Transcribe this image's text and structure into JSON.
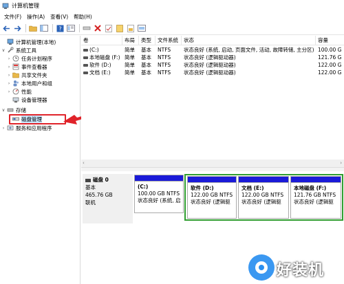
{
  "window": {
    "title": "计算机管理"
  },
  "menu": {
    "items": [
      "文件(F)",
      "操作(A)",
      "查看(V)",
      "帮助(H)"
    ]
  },
  "toolbar": {
    "buttons": [
      "back-icon",
      "forward-icon",
      "up-folder-icon",
      "show-hide-tree-icon",
      "help-icon",
      "properties-icon",
      "connect-icon",
      "delete-icon",
      "check-icon",
      "export-icon",
      "open-icon",
      "settings-icon"
    ]
  },
  "tree": {
    "items": [
      {
        "label": "计算机管理(本地)",
        "expander": "",
        "icon": "computer-icon"
      },
      {
        "label": "系统工具",
        "expander": "∨",
        "icon": "tools-icon"
      },
      {
        "label": "任务计划程序",
        "expander": "›",
        "icon": "clock-icon"
      },
      {
        "label": "事件查看器",
        "expander": "›",
        "icon": "event-viewer-icon"
      },
      {
        "label": "共享文件夹",
        "expander": "›",
        "icon": "shared-folder-icon"
      },
      {
        "label": "本地用户和组",
        "expander": "›",
        "icon": "users-icon"
      },
      {
        "label": "性能",
        "expander": "›",
        "icon": "performance-icon"
      },
      {
        "label": "设备管理器",
        "expander": "",
        "icon": "device-manager-icon"
      },
      {
        "label": "存储",
        "expander": "∨",
        "icon": "storage-icon"
      },
      {
        "label": "磁盘管理",
        "expander": "",
        "icon": "disk-management-icon"
      },
      {
        "label": "服务和应用程序",
        "expander": "›",
        "icon": "services-icon"
      }
    ]
  },
  "volumes": {
    "columns": [
      "卷",
      "布局",
      "类型",
      "文件系统",
      "状态",
      "容量"
    ],
    "rows": [
      [
        "(C:)",
        "简单",
        "基本",
        "NTFS",
        "状态良好 (系统, 启动, 页面文件, 活动, 故障转储, 主分区)",
        "100.00 G"
      ],
      [
        "本地磁盘 (F:)",
        "简单",
        "基本",
        "NTFS",
        "状态良好 (逻辑驱动器)",
        "121.76 G"
      ],
      [
        "软件 (D:)",
        "简单",
        "基本",
        "NTFS",
        "状态良好 (逻辑驱动器)",
        "122.00 G"
      ],
      [
        "文档 (E:)",
        "简单",
        "基本",
        "NTFS",
        "状态良好 (逻辑驱动器)",
        "122.00 G"
      ]
    ]
  },
  "disk": {
    "name": "磁盘 0",
    "type": "基本",
    "size": "465.76 GB",
    "status": "联机",
    "partitions": [
      {
        "name": "(C:)",
        "size": "100.00 GB NTFS",
        "status": "状态良好 (系统, 启"
      },
      {
        "name": "软件  (D:)",
        "size": "122.00 GB NTFS",
        "status": "状态良好 (逻辑驱"
      },
      {
        "name": "文档  (E:)",
        "size": "122.00 GB NTFS",
        "status": "状态良好 (逻辑驱"
      },
      {
        "name": "本地磁盘  (F:)",
        "size": "121.76 GB NTFS",
        "status": "状态良好 (逻辑驱"
      }
    ]
  },
  "watermark": {
    "text": "好装机"
  },
  "colors": {
    "partition_bar": "#1a1ad8",
    "extended_border": "#2e9d2e",
    "callout": "#e0232a",
    "selection": "#cce8ff"
  }
}
